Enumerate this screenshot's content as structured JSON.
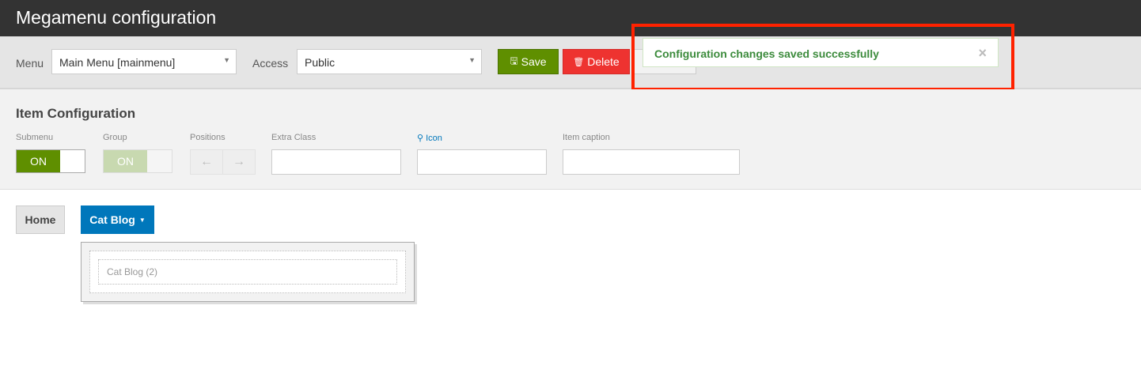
{
  "title": "Megamenu configuration",
  "toolbar": {
    "menu_label": "Menu",
    "menu_value": "Main Menu [mainmenu]",
    "access_label": "Access",
    "access_value": "Public",
    "save": "Save",
    "delete": "Delete"
  },
  "notification": {
    "message": "Configuration changes saved successfully",
    "close": "×"
  },
  "item_config": {
    "heading": "Item Configuration",
    "submenu_label": "Submenu",
    "submenu_state": "ON",
    "group_label": "Group",
    "group_state": "ON",
    "positions_label": "Positions",
    "extra_class_label": "Extra Class",
    "icon_label": "Icon",
    "caption_label": "Item caption"
  },
  "menu": {
    "items": [
      "Home",
      "Cat Blog"
    ],
    "dropdown_item": "Cat Blog (2)"
  },
  "colors": {
    "save": "#5f8f00",
    "delete": "#ee3330",
    "active": "#0077bb",
    "success": "#3c8b3c",
    "highlight": "#ff2200"
  }
}
